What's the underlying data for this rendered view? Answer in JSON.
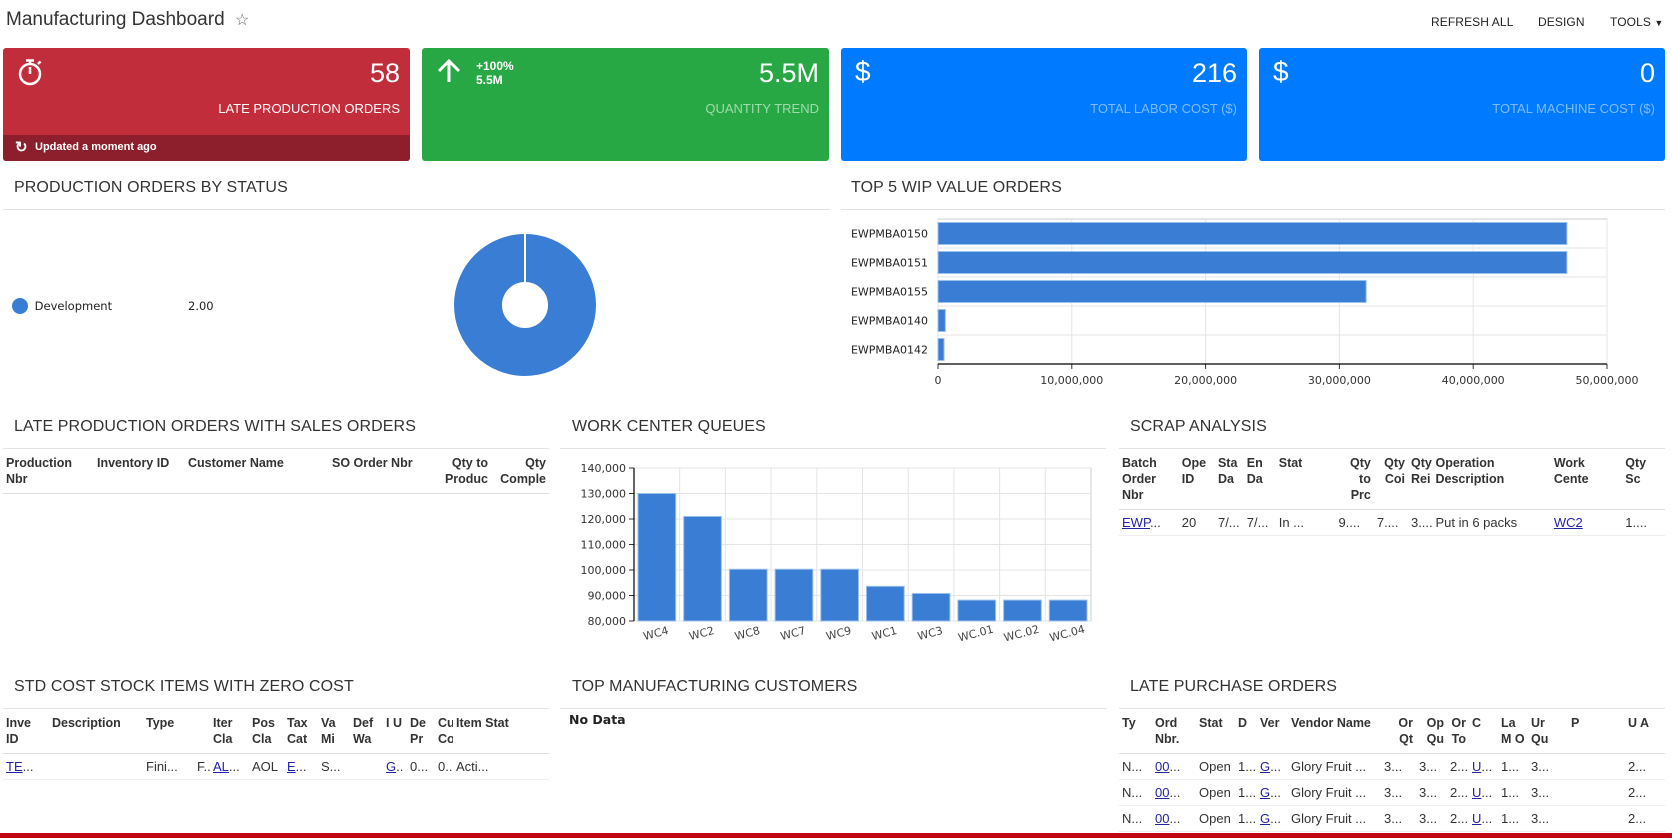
{
  "header": {
    "title": "Manufacturing Dashboard",
    "favorite_icon": "star-outline-icon",
    "buttons": {
      "refresh_all": "REFRESH ALL",
      "design": "DESIGN",
      "tools": "TOOLS"
    }
  },
  "tiles": [
    {
      "icon": "stopwatch-icon",
      "value": "58",
      "label": "LATE PRODUCTION ORDERS",
      "color": "#c22d3b",
      "label_color": "#ffffff",
      "footer": "Updated a moment ago",
      "footer_icon": "refresh-icon"
    },
    {
      "icon": "arrow-up-icon",
      "value": "5.5M",
      "label": "QUANTITY TREND",
      "color": "#28a745",
      "label_color": "#9fdcac",
      "trend_pct": "+100%",
      "trend_value": "5.5M"
    },
    {
      "icon": "dollar-icon",
      "value": "216",
      "label": "TOTAL LABOR COST ($)",
      "color": "#007bff",
      "label_color": "#7fbcff"
    },
    {
      "icon": "dollar-icon",
      "value": "0",
      "label": "TOTAL MACHINE COST ($)",
      "color": "#007bff",
      "label_color": "#7fbcff"
    }
  ],
  "widgets": {
    "status": {
      "title": "PRODUCTION ORDERS BY STATUS"
    },
    "wip": {
      "title": "TOP 5 WIP VALUE ORDERS"
    },
    "late_so": {
      "title": "LATE PRODUCTION ORDERS WITH SALES ORDERS",
      "columns": [
        "Production Nbr",
        "Inventory ID",
        "Customer Name",
        "SO Order Nbr",
        "Qty to Produc",
        "Qty Comple"
      ]
    },
    "wc_queues": {
      "title": "WORK CENTER QUEUES"
    },
    "scrap": {
      "title": "SCRAP ANALYSIS",
      "columns": [
        "Batch Order Nbr",
        "Ope ID",
        "Sta Da",
        "En Da",
        "Stat",
        "Qty to Prc",
        "Qty Coi",
        "Qty Rei",
        "Operation Description",
        "Work Cente",
        "Qty Sc"
      ],
      "rows": [
        [
          "EWP...",
          "20",
          "7/...",
          "7/...",
          "In ...",
          "9....",
          "7....",
          "3....",
          "Put in 6 packs",
          "WC2",
          "1...."
        ]
      ]
    },
    "std_cost": {
      "title": "STD COST STOCK ITEMS WITH ZERO COST",
      "columns": [
        "Inve ID",
        "Description",
        "Type",
        "",
        "Iter Cla",
        "Pos Cla",
        "Tax Cat",
        "Va Mi",
        "Def Wa",
        "I U",
        "De Pr",
        "Cu Co",
        "Item Stat"
      ],
      "rows": [
        [
          "TE...",
          "",
          "Fini...",
          "F..",
          "AL...",
          "AOL",
          "E...",
          "S...",
          "",
          "G..",
          "0...",
          "0...",
          "Acti..."
        ]
      ]
    },
    "top_customers": {
      "title": "TOP MANUFACTURING CUSTOMERS",
      "empty_text": "No Data"
    },
    "late_po": {
      "title": "LATE PURCHASE ORDERS",
      "columns": [
        "Ty",
        "Ord Nbr.",
        "Stat",
        "D",
        "Ver",
        "Vendor Name",
        "Or Qt",
        "Op Qu",
        "Or To",
        "C",
        "La M O",
        "Ur Qu",
        "P",
        "U A"
      ],
      "rows": [
        [
          "N...",
          "00...",
          "Open",
          "1...",
          "G...",
          "Glory Fruit ...",
          "3...",
          "3...",
          "2...",
          "U...",
          "1...",
          "3...",
          "",
          "2..."
        ],
        [
          "N...",
          "00...",
          "Open",
          "1...",
          "G...",
          "Glory Fruit ...",
          "3...",
          "3...",
          "2...",
          "U...",
          "1...",
          "3...",
          "",
          "2..."
        ],
        [
          "N...",
          "00...",
          "Open",
          "1...",
          "G...",
          "Glory Fruit ...",
          "3...",
          "3...",
          "2...",
          "U...",
          "1...",
          "3...",
          "",
          "2..."
        ]
      ]
    }
  },
  "chart_data": [
    {
      "id": "status",
      "type": "pie",
      "title": "PRODUCTION ORDERS BY STATUS",
      "donut": true,
      "legend_placement": "left",
      "slices": [
        {
          "label": "Development",
          "value": 2.0,
          "value_text": "2.00",
          "color": "#3a7dd4"
        }
      ]
    },
    {
      "id": "wip",
      "type": "bar",
      "orientation": "horizontal",
      "title": "TOP 5 WIP VALUE ORDERS",
      "categories": [
        "EWPMBA0150",
        "EWPMBA0151",
        "EWPMBA0155",
        "EWPMBA0140",
        "EWPMBA0142"
      ],
      "values": [
        47000000,
        47000000,
        32000000,
        550000,
        450000
      ],
      "xlim": [
        0,
        50000000
      ],
      "xticks": [
        0,
        10000000,
        20000000,
        30000000,
        40000000,
        50000000
      ],
      "xtick_labels": [
        "0",
        "10,000,000",
        "20,000,000",
        "30,000,000",
        "40,000,000",
        "50,000,000"
      ],
      "grid": true,
      "color": "#3a7dd4"
    },
    {
      "id": "wc_queues",
      "type": "bar",
      "title": "WORK CENTER QUEUES",
      "categories": [
        "WC4",
        "WC2",
        "WC8",
        "WC7",
        "WC9",
        "WC1",
        "WC3",
        "WC.01",
        "WC.02",
        "WC.04"
      ],
      "values": [
        130000,
        121000,
        100300,
        100300,
        100300,
        93600,
        90800,
        88200,
        88200,
        88200
      ],
      "ylim": [
        80000,
        140000
      ],
      "yticks": [
        80000,
        90000,
        100000,
        110000,
        120000,
        130000,
        140000
      ],
      "ytick_labels": [
        "80,000",
        "90,000",
        "100,000",
        "110,000",
        "120,000",
        "130,000",
        "140,000"
      ],
      "grid": true,
      "color": "#3a7dd4"
    }
  ]
}
